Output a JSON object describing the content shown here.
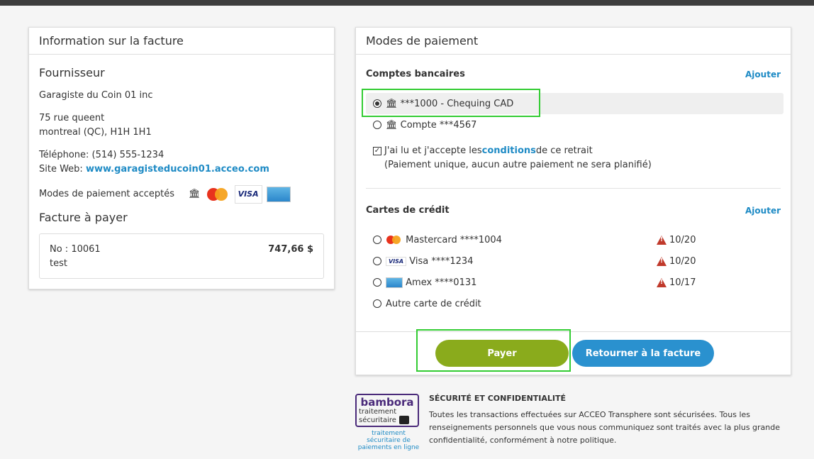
{
  "invoice_panel": {
    "title": "Information sur la facture",
    "supplier_heading": "Fournisseur",
    "supplier_name": "Garagiste du Coin 01 inc",
    "address_line1": "75 rue queent",
    "address_line2": "montreal (QC), H1H 1H1",
    "phone": "Téléphone: (514) 555-1234",
    "website_label": "Site Web: ",
    "website_url": "www.garagisteducoin01.acceo.com",
    "accepted_methods_label": "Modes de paiement acceptés",
    "accepted_methods_icons": [
      "bank-icon",
      "mastercard-icon",
      "visa-icon",
      "amex-icon"
    ],
    "invoice_heading": "Facture à payer",
    "invoice_number": "No : 10061",
    "invoice_amount": "747,66 $",
    "invoice_description": "test"
  },
  "payment_panel": {
    "title": "Modes de paiement",
    "bank_section_label": "Comptes bancaires",
    "bank_add_label": "Ajouter",
    "bank_accounts": [
      {
        "label": "***1000 - Chequing CAD",
        "selected": true
      },
      {
        "label": "Compte ***4567",
        "selected": false
      }
    ],
    "consent_prefix": "J'ai lu et j'accepte les ",
    "consent_link": "conditions",
    "consent_suffix": " de ce retrait",
    "consent_note": "(Paiement unique, aucun autre paiement ne sera planifié)",
    "consent_checked": true,
    "card_section_label": "Cartes de crédit",
    "card_add_label": "Ajouter",
    "cards": [
      {
        "brand": "mastercard",
        "label": "Mastercard ****1004",
        "expiry": "10/20"
      },
      {
        "brand": "visa",
        "label": "Visa ****1234",
        "expiry": "10/20"
      },
      {
        "brand": "amex",
        "label": "Amex ****0131",
        "expiry": "10/17"
      }
    ],
    "other_card_label": "Autre carte de crédit",
    "pay_button": "Payer",
    "back_button": "Retourner à la facture"
  },
  "security": {
    "badge_name": "bambora",
    "badge_line1": "traitement",
    "badge_line2": "sécuritaire",
    "badge_footer": "traitement sécuritaire de paiements en ligne",
    "title": "SÉCURITÉ ET CONFIDENTIALITÉ",
    "body": "Toutes les transactions effectuées sur ACCEO Transphere sont sécurisées. Tous les renseignements personnels que vous nous communiquez sont traités avec la plus grande confidentialité, conformément à notre politique."
  },
  "colors": {
    "link": "#1f8bc5",
    "pay_button": "#8aab1c",
    "back_button": "#2a91cf",
    "warning": "#c0392b",
    "highlight": "#33cc33"
  }
}
